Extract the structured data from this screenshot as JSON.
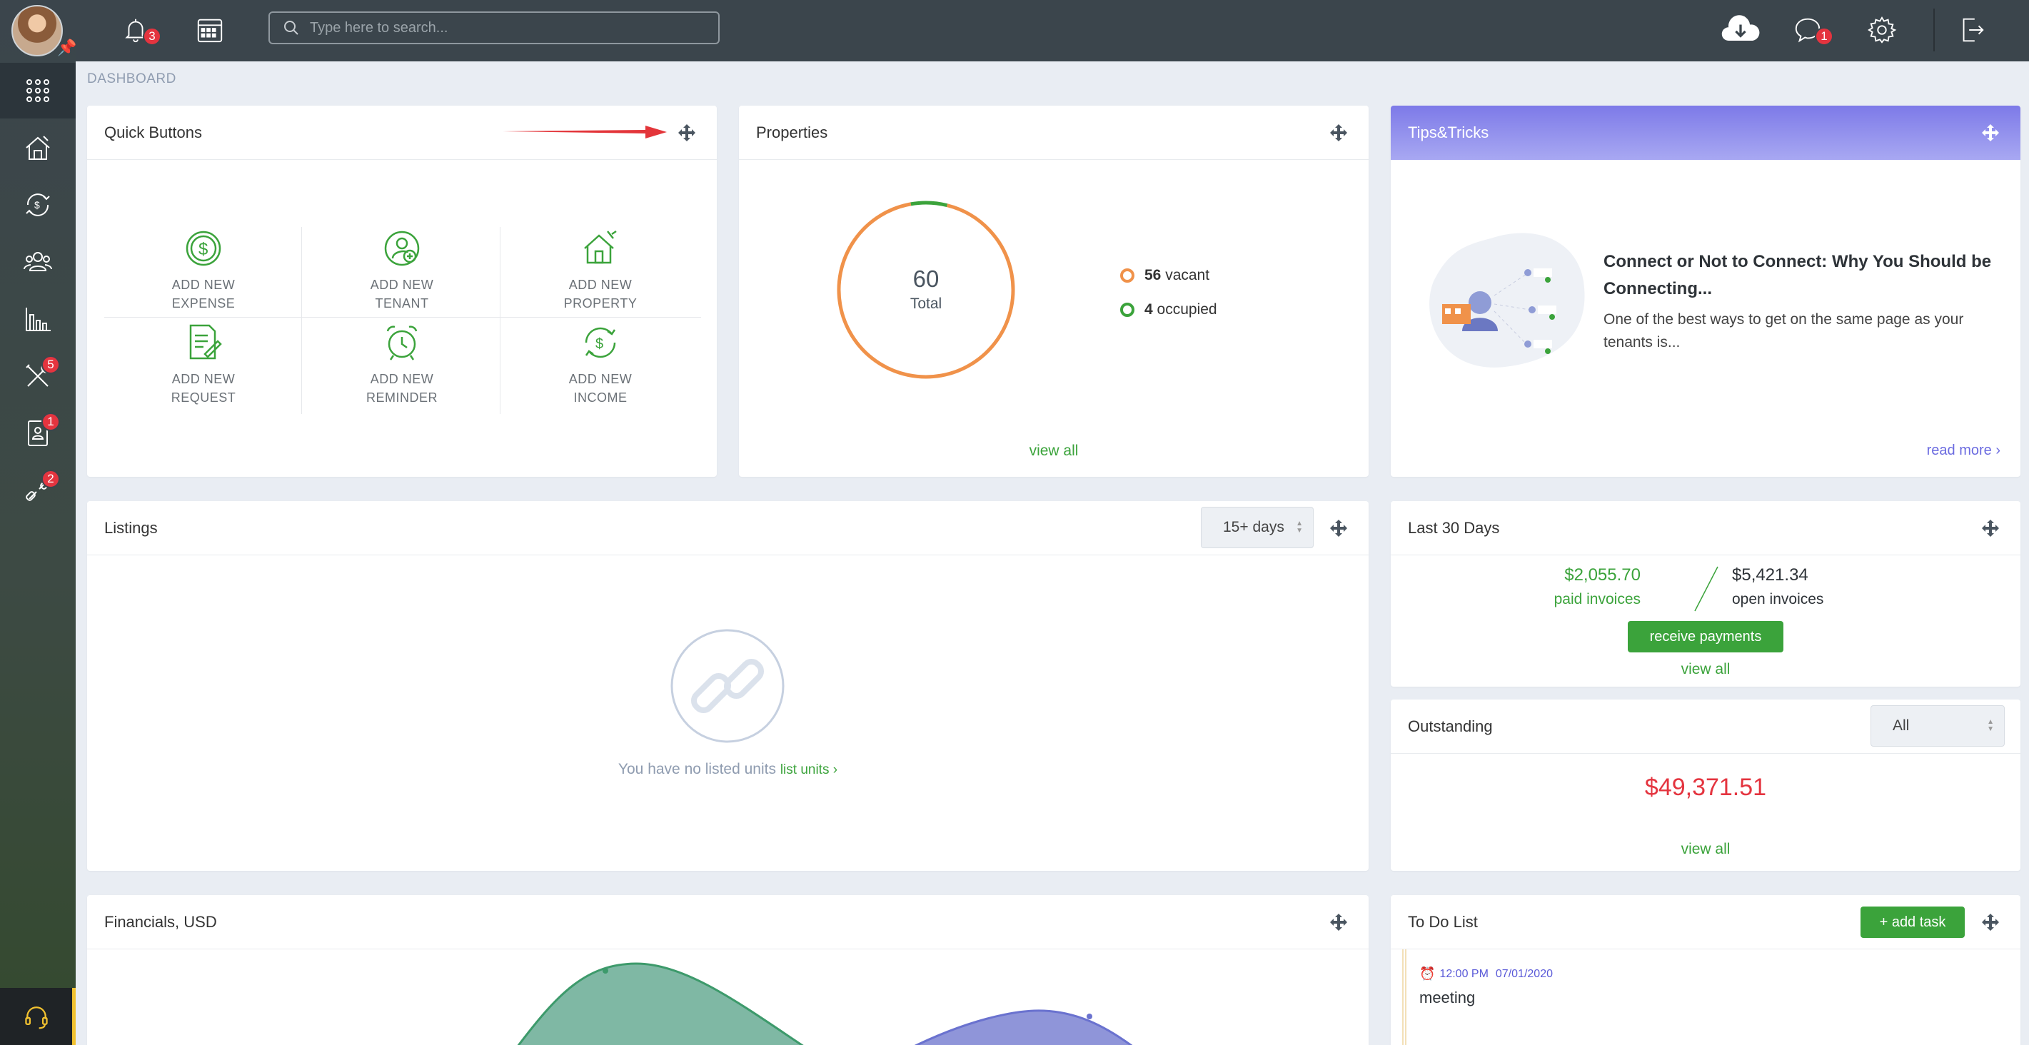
{
  "topbar": {
    "notifications_count": "3",
    "messages_count": "1",
    "search_placeholder": "Type here to search..."
  },
  "sidebar": {
    "badges": {
      "maintenance": "5",
      "leases": "1",
      "tools": "2"
    }
  },
  "breadcrumb": "DASHBOARD",
  "quick_buttons": {
    "title": "Quick Buttons",
    "items": [
      {
        "line1": "ADD NEW",
        "line2": "EXPENSE"
      },
      {
        "line1": "ADD NEW",
        "line2": "TENANT"
      },
      {
        "line1": "ADD NEW",
        "line2": "PROPERTY"
      },
      {
        "line1": "ADD NEW",
        "line2": "REQUEST"
      },
      {
        "line1": "ADD NEW",
        "line2": "REMINDER"
      },
      {
        "line1": "ADD NEW",
        "line2": "INCOME"
      }
    ]
  },
  "properties": {
    "title": "Properties",
    "total_value": "60",
    "total_label": "Total",
    "vacant_count": 56,
    "vacant_count_text": "56",
    "vacant_label": "vacant",
    "occupied_count": 4,
    "occupied_count_text": "4",
    "occupied_label": "occupied",
    "view_all": "view all",
    "colors": {
      "vacant": "#f0924a",
      "occupied": "#3ba33b"
    }
  },
  "tips": {
    "title": "Tips&Tricks",
    "headline": "Connect or Not to Connect: Why You Should be Connecting...",
    "body": "One of the best ways to get on the same page as your tenants is...",
    "read_more": "read more"
  },
  "listings": {
    "title": "Listings",
    "filter_value": "15+ days",
    "empty_text": "You have no listed units",
    "empty_link": "list units"
  },
  "last30": {
    "title": "Last 30 Days",
    "paid_amount": "$2,055.70",
    "paid_label": "paid invoices",
    "open_amount": "$5,421.34",
    "open_label": "open invoices",
    "button": "receive payments",
    "view_all": "view all"
  },
  "outstanding": {
    "title": "Outstanding",
    "filter_value": "All",
    "amount": "$49,371.51",
    "view_all": "view all"
  },
  "financials": {
    "title": "Financials, USD"
  },
  "todo": {
    "title": "To Do List",
    "add_button": "+ add task",
    "items": [
      {
        "time": "12:00 PM",
        "date": "07/01/2020",
        "text": "meeting"
      }
    ]
  }
}
